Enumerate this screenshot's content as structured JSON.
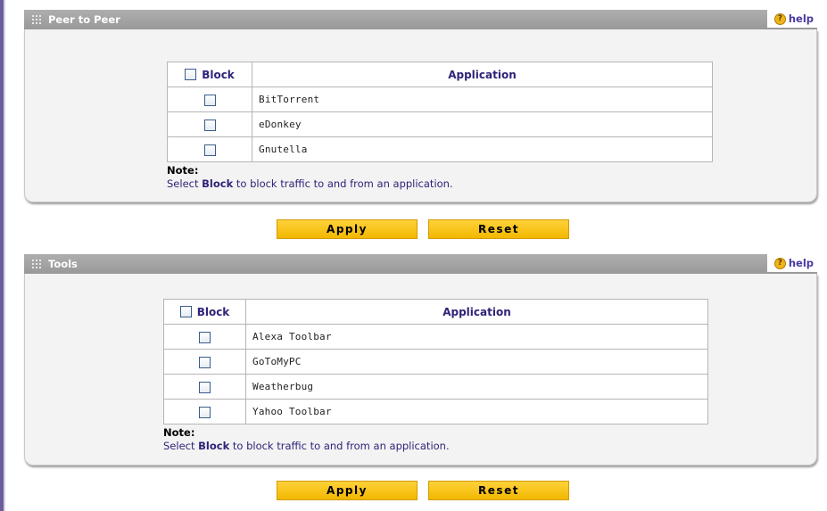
{
  "sections": [
    {
      "title": "Peer to Peer",
      "help_label": "help",
      "block_header": "Block",
      "app_header": "Application",
      "apps": [
        "BitTorrent",
        "eDonkey",
        "Gnutella"
      ],
      "note_label": "Note:",
      "note_pre": "Select ",
      "note_bold": "Block",
      "note_post": " to block traffic to and from an application.",
      "apply_label": "Apply",
      "reset_label": "Reset"
    },
    {
      "title": "Tools",
      "help_label": "help",
      "block_header": "Block",
      "app_header": "Application",
      "apps": [
        "Alexa Toolbar",
        "GoToMyPC",
        "Weatherbug",
        "Yahoo Toolbar"
      ],
      "note_label": "Note:",
      "note_pre": "Select ",
      "note_bold": "Block",
      "note_post": " to block traffic to and from an application.",
      "apply_label": "Apply",
      "reset_label": "Reset"
    }
  ],
  "colors": {
    "header_gray": "#a3a3a3",
    "button_yellow": "#f7c20c",
    "link_purple": "#2d2479"
  }
}
